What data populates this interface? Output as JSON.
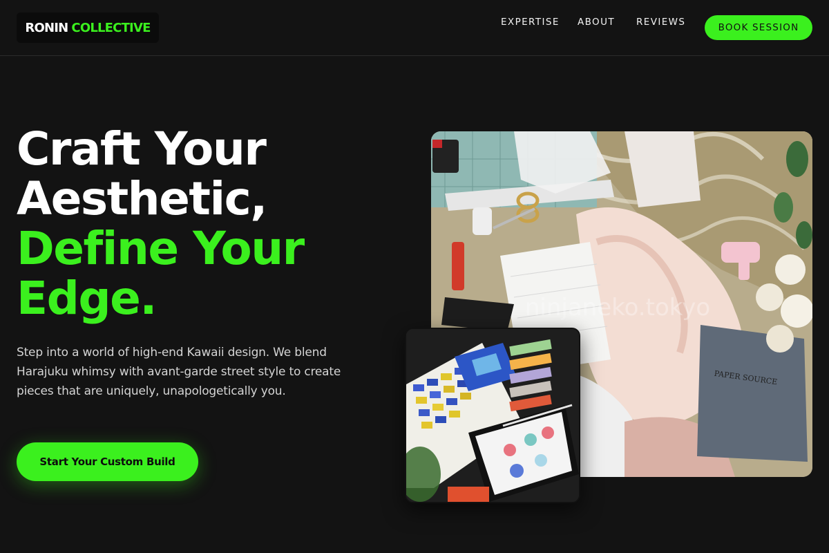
{
  "brand": {
    "name_part1": "RONIN",
    "name_part2": "COLLECTIVE"
  },
  "nav": {
    "items": [
      {
        "label": "EXPERTISE"
      },
      {
        "label": "ABOUT"
      },
      {
        "label": "REVIEWS"
      }
    ],
    "book_label": "BOOK SESSION"
  },
  "hero": {
    "headline_line1": "Craft Your",
    "headline_line2": "Aesthetic,",
    "headline_line3": "Define Your",
    "headline_line4": "Edge.",
    "subtext": "Step into a world of high-end Kawaii design. We blend Harajuku whimsy with avant-garde street style to create pieces that are uniquely, unapologetically you.",
    "cta_label": "Start Your Custom Build"
  },
  "images": {
    "main_watermark": "ninjaneko.tokyo",
    "main_booklet_text": "PAPER SOURCE"
  },
  "colors": {
    "accent": "#3bf01e",
    "background": "#131313",
    "text": "#ffffff",
    "muted_text": "#d4d4d4"
  }
}
